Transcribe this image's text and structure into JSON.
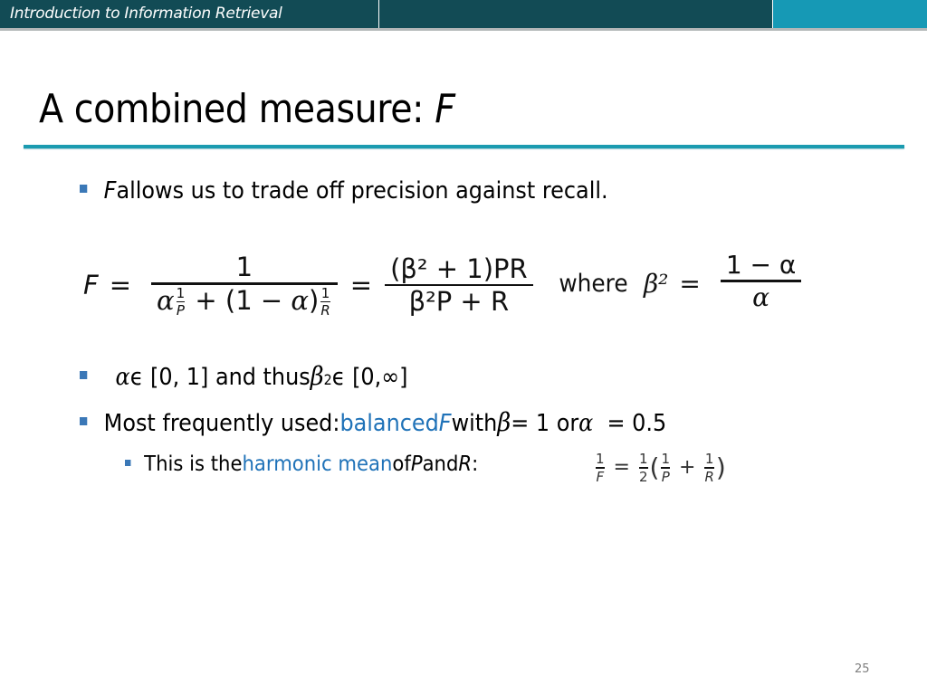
{
  "header": {
    "course_title": "Introduction to Information Retrieval",
    "colors": {
      "dark_bar": "#124b55",
      "accent_bar": "#1699b5",
      "title_rule": "#1b9bb0"
    }
  },
  "slide": {
    "title_text": "A combined measure: ",
    "title_var": "F",
    "page_number": "25",
    "bullets": [
      {
        "var": "F",
        "text": " allows us to trade off precision against recall."
      },
      {
        "alpha": "α",
        "range1": " ϵ [0, 1] and thus ",
        "beta": "β",
        "exp": "2",
        "range2": " ϵ [0,∞]"
      },
      {
        "prefix": "Most frequently used: ",
        "highlight": "balanced ",
        "highlight_var": "F",
        "mid": " with ",
        "beta": "β",
        "eq1": " = 1 or ",
        "alpha": "α",
        "eq2": "  = 0.5"
      }
    ],
    "sub_bullet": {
      "prefix": "This is the ",
      "highlight": "harmonic mean",
      "mid": " of ",
      "p": "P",
      "and": " and ",
      "r": "R",
      "colon": ":"
    },
    "main_formula": {
      "lhs": "F",
      "equals": "=",
      "frac1_num": "1",
      "frac1_den_alpha": "α",
      "frac1_den_plus": " + (1 − ",
      "frac1_den_close": ")",
      "one": "1",
      "P": "P",
      "R": "R",
      "frac2_num": "(β² + 1)PR",
      "frac2_den": "β²P + R"
    },
    "where_formula": {
      "where": "where",
      "lhs": "β²",
      "equals": "=",
      "num": "1 − α",
      "den": "α"
    },
    "harmonic_formula": {
      "one": "1",
      "F": "F",
      "equals": "=",
      "two": "2",
      "open": "(",
      "P": "P",
      "plus": "+",
      "R": "R",
      "close": ")"
    },
    "colors": {
      "bullet": "#3b78b7",
      "highlight": "#1f72b8"
    }
  }
}
